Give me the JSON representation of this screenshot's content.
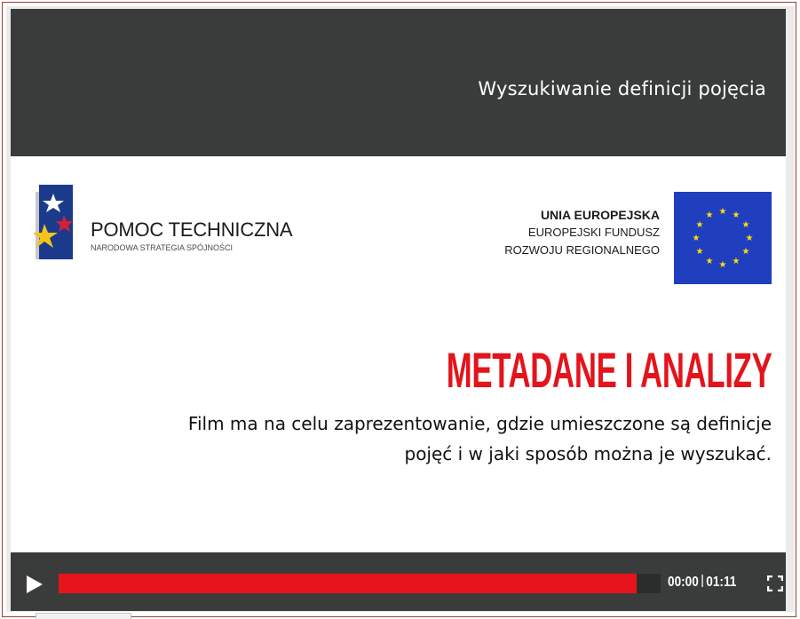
{
  "header": {
    "title": "Wyszukiwanie definicji pojęcia"
  },
  "logo_left": {
    "name": "POMOC TECHNICZNA",
    "subtitle": "NARODOWA STRATEGIA SPÓJNOŚCI"
  },
  "eu_logo": {
    "line1": "UNIA EUROPEJSKA",
    "line2": "EUROPEJSKI FUNDUSZ",
    "line3": "ROZWOJU REGIONALNEGO",
    "flag_color": "#1f3fbf",
    "star_color": "#ffdd00"
  },
  "slide": {
    "heading": "METADANE I ANALIZY",
    "heading_color": "#e3141b",
    "description_line1": "Film ma na celu zaprezentowanie, gdzie umieszczone są definicje",
    "description_line2": "pojęć i w jaki sposób można je wyszukać."
  },
  "controls": {
    "play_icon": "play-icon",
    "current_time": "00:00",
    "duration": "01:11",
    "progress_fraction": 0.96,
    "progress_color": "#e8141b",
    "fullscreen_icon": "fullscreen-icon"
  }
}
